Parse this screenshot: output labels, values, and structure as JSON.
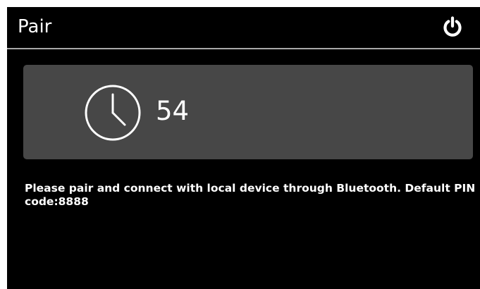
{
  "header": {
    "title": "Pair",
    "power_icon": "power-icon"
  },
  "pairing": {
    "clock_icon": "clock-icon",
    "countdown": "54",
    "message": "Please pair and connect with local device through Bluetooth. Default PIN code:8888"
  },
  "colors": {
    "background": "#000000",
    "panel": "#474747",
    "text": "#ffffff",
    "header_divider": "#a9a9a9"
  }
}
